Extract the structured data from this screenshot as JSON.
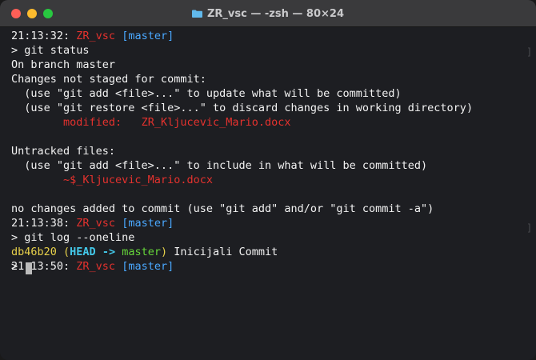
{
  "window": {
    "title": "ZR_vsc — -zsh — 80×24",
    "icon": "folder-icon"
  },
  "terminal": {
    "prompt1": {
      "time": "21:13:32:",
      "dir": "ZR_vsc",
      "branch": "[master]"
    },
    "cmd1": "> git status",
    "out1": "On branch master",
    "out2": "Changes not staged for commit:",
    "out3": "  (use \"git add <file>...\" to update what will be committed)",
    "out4": "  (use \"git restore <file>...\" to discard changes in working directory)",
    "modified_label": "        modified:   ",
    "modified_file": "ZR_Kljucevic_Mario.docx",
    "out6": "",
    "out7": "Untracked files:",
    "out8": "  (use \"git add <file>...\" to include in what will be committed)",
    "untracked_file": "        ~$_Kljucevic_Mario.docx",
    "out10": "",
    "out11": "no changes added to commit (use \"git add\" and/or \"git commit -a\")",
    "prompt2": {
      "time": "21:13:38:",
      "dir": "ZR_vsc",
      "branch": "[master]"
    },
    "cmd2": "> git log --oneline",
    "log": {
      "hash": "db46b20",
      "open": " (",
      "head": "HEAD",
      "arrow": " -> ",
      "branch": "master",
      "close": ")",
      "message": " Inicijali Commit"
    },
    "prompt3": {
      "time": "21:13:50:",
      "dir": "ZR_vsc",
      "branch": "[master]"
    },
    "cmd3": "> "
  },
  "colors": {
    "background": "#1d1e22",
    "red": "#e5322e",
    "pink": "#ff3b86",
    "blue": "#4aa8ff",
    "green": "#66d63a",
    "yellow": "#e7d04a",
    "cyan": "#43c8e9"
  }
}
